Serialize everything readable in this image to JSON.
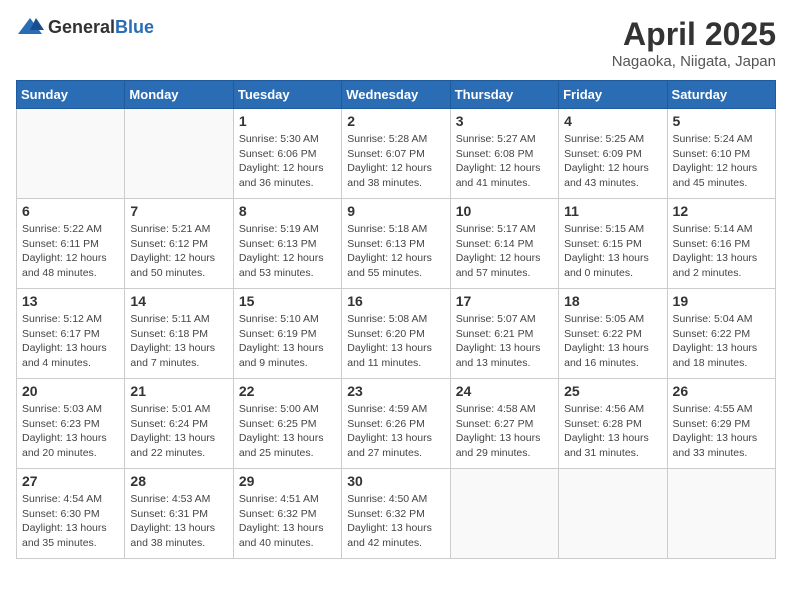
{
  "header": {
    "logo_general": "General",
    "logo_blue": "Blue",
    "title": "April 2025",
    "location": "Nagaoka, Niigata, Japan"
  },
  "days_of_week": [
    "Sunday",
    "Monday",
    "Tuesday",
    "Wednesday",
    "Thursday",
    "Friday",
    "Saturday"
  ],
  "weeks": [
    [
      {
        "day": "",
        "info": ""
      },
      {
        "day": "",
        "info": ""
      },
      {
        "day": "1",
        "info": "Sunrise: 5:30 AM\nSunset: 6:06 PM\nDaylight: 12 hours and 36 minutes."
      },
      {
        "day": "2",
        "info": "Sunrise: 5:28 AM\nSunset: 6:07 PM\nDaylight: 12 hours and 38 minutes."
      },
      {
        "day": "3",
        "info": "Sunrise: 5:27 AM\nSunset: 6:08 PM\nDaylight: 12 hours and 41 minutes."
      },
      {
        "day": "4",
        "info": "Sunrise: 5:25 AM\nSunset: 6:09 PM\nDaylight: 12 hours and 43 minutes."
      },
      {
        "day": "5",
        "info": "Sunrise: 5:24 AM\nSunset: 6:10 PM\nDaylight: 12 hours and 45 minutes."
      }
    ],
    [
      {
        "day": "6",
        "info": "Sunrise: 5:22 AM\nSunset: 6:11 PM\nDaylight: 12 hours and 48 minutes."
      },
      {
        "day": "7",
        "info": "Sunrise: 5:21 AM\nSunset: 6:12 PM\nDaylight: 12 hours and 50 minutes."
      },
      {
        "day": "8",
        "info": "Sunrise: 5:19 AM\nSunset: 6:13 PM\nDaylight: 12 hours and 53 minutes."
      },
      {
        "day": "9",
        "info": "Sunrise: 5:18 AM\nSunset: 6:13 PM\nDaylight: 12 hours and 55 minutes."
      },
      {
        "day": "10",
        "info": "Sunrise: 5:17 AM\nSunset: 6:14 PM\nDaylight: 12 hours and 57 minutes."
      },
      {
        "day": "11",
        "info": "Sunrise: 5:15 AM\nSunset: 6:15 PM\nDaylight: 13 hours and 0 minutes."
      },
      {
        "day": "12",
        "info": "Sunrise: 5:14 AM\nSunset: 6:16 PM\nDaylight: 13 hours and 2 minutes."
      }
    ],
    [
      {
        "day": "13",
        "info": "Sunrise: 5:12 AM\nSunset: 6:17 PM\nDaylight: 13 hours and 4 minutes."
      },
      {
        "day": "14",
        "info": "Sunrise: 5:11 AM\nSunset: 6:18 PM\nDaylight: 13 hours and 7 minutes."
      },
      {
        "day": "15",
        "info": "Sunrise: 5:10 AM\nSunset: 6:19 PM\nDaylight: 13 hours and 9 minutes."
      },
      {
        "day": "16",
        "info": "Sunrise: 5:08 AM\nSunset: 6:20 PM\nDaylight: 13 hours and 11 minutes."
      },
      {
        "day": "17",
        "info": "Sunrise: 5:07 AM\nSunset: 6:21 PM\nDaylight: 13 hours and 13 minutes."
      },
      {
        "day": "18",
        "info": "Sunrise: 5:05 AM\nSunset: 6:22 PM\nDaylight: 13 hours and 16 minutes."
      },
      {
        "day": "19",
        "info": "Sunrise: 5:04 AM\nSunset: 6:22 PM\nDaylight: 13 hours and 18 minutes."
      }
    ],
    [
      {
        "day": "20",
        "info": "Sunrise: 5:03 AM\nSunset: 6:23 PM\nDaylight: 13 hours and 20 minutes."
      },
      {
        "day": "21",
        "info": "Sunrise: 5:01 AM\nSunset: 6:24 PM\nDaylight: 13 hours and 22 minutes."
      },
      {
        "day": "22",
        "info": "Sunrise: 5:00 AM\nSunset: 6:25 PM\nDaylight: 13 hours and 25 minutes."
      },
      {
        "day": "23",
        "info": "Sunrise: 4:59 AM\nSunset: 6:26 PM\nDaylight: 13 hours and 27 minutes."
      },
      {
        "day": "24",
        "info": "Sunrise: 4:58 AM\nSunset: 6:27 PM\nDaylight: 13 hours and 29 minutes."
      },
      {
        "day": "25",
        "info": "Sunrise: 4:56 AM\nSunset: 6:28 PM\nDaylight: 13 hours and 31 minutes."
      },
      {
        "day": "26",
        "info": "Sunrise: 4:55 AM\nSunset: 6:29 PM\nDaylight: 13 hours and 33 minutes."
      }
    ],
    [
      {
        "day": "27",
        "info": "Sunrise: 4:54 AM\nSunset: 6:30 PM\nDaylight: 13 hours and 35 minutes."
      },
      {
        "day": "28",
        "info": "Sunrise: 4:53 AM\nSunset: 6:31 PM\nDaylight: 13 hours and 38 minutes."
      },
      {
        "day": "29",
        "info": "Sunrise: 4:51 AM\nSunset: 6:32 PM\nDaylight: 13 hours and 40 minutes."
      },
      {
        "day": "30",
        "info": "Sunrise: 4:50 AM\nSunset: 6:32 PM\nDaylight: 13 hours and 42 minutes."
      },
      {
        "day": "",
        "info": ""
      },
      {
        "day": "",
        "info": ""
      },
      {
        "day": "",
        "info": ""
      }
    ]
  ]
}
